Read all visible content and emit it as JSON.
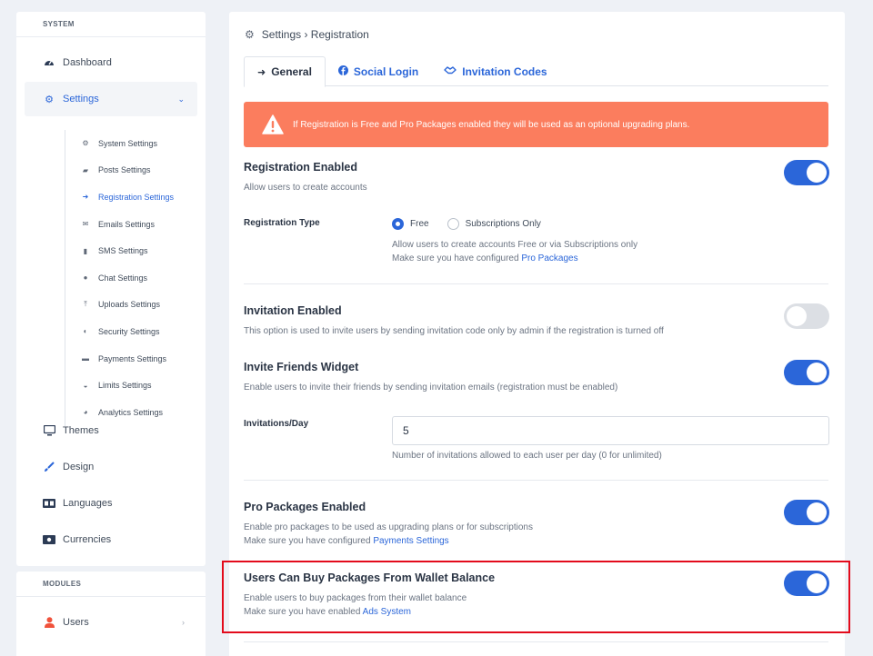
{
  "sidebar": {
    "system_label": "SYSTEM",
    "modules_label": "MODULES",
    "items": [
      {
        "label": "Dashboard",
        "icon": "gauge-icon"
      },
      {
        "label": "Settings",
        "icon": "gear-icon"
      },
      {
        "label": "Themes",
        "icon": "monitor-icon"
      },
      {
        "label": "Design",
        "icon": "brush-icon"
      },
      {
        "label": "Languages",
        "icon": "language-icon"
      },
      {
        "label": "Currencies",
        "icon": "money-icon"
      }
    ],
    "sub_items": [
      {
        "label": "System Settings",
        "icon": "gears-icon"
      },
      {
        "label": "Posts Settings",
        "icon": "comment-icon"
      },
      {
        "label": "Registration Settings",
        "icon": "sign-in-icon"
      },
      {
        "label": "Emails Settings",
        "icon": "envelope-open-icon"
      },
      {
        "label": "SMS Settings",
        "icon": "mobile-icon"
      },
      {
        "label": "Chat Settings",
        "icon": "comments-icon"
      },
      {
        "label": "Uploads Settings",
        "icon": "upload-icon"
      },
      {
        "label": "Security Settings",
        "icon": "shield-icon"
      },
      {
        "label": "Payments Settings",
        "icon": "credit-card-icon"
      },
      {
        "label": "Limits Settings",
        "icon": "tachometer-icon"
      },
      {
        "label": "Analytics Settings",
        "icon": "pie-chart-icon"
      }
    ],
    "module_items": [
      {
        "label": "Users",
        "icon": "user-icon"
      }
    ]
  },
  "breadcrumb": "Settings › Registration",
  "tabs": [
    {
      "label": "General",
      "icon": "sign-in-icon"
    },
    {
      "label": "Social Login",
      "icon": "facebook-icon"
    },
    {
      "label": "Invitation Codes",
      "icon": "handshake-icon"
    }
  ],
  "alert": "If Registration is Free and Pro Packages enabled they will be used as an optional upgrading plans.",
  "registration": {
    "title": "Registration Enabled",
    "desc": "Allow users to create accounts",
    "enabled": true
  },
  "registration_type": {
    "label": "Registration Type",
    "options": [
      "Free",
      "Subscriptions Only"
    ],
    "selected": "Free",
    "help": "Allow users to create accounts Free or via Subscriptions only",
    "help2_prefix": "Make sure you have configured ",
    "help2_link": "Pro Packages"
  },
  "invitation": {
    "title": "Invitation Enabled",
    "desc": "This option is used to invite users by sending invitation code only by admin if the registration is turned off",
    "enabled": false
  },
  "invite_friends": {
    "title": "Invite Friends Widget",
    "desc": "Enable users to invite their friends by sending invitation emails (registration must be enabled)",
    "enabled": true
  },
  "invitations_day": {
    "label": "Invitations/Day",
    "value": "5",
    "help": "Number of invitations allowed to each user per day (0 for unlimited)"
  },
  "pro_packages": {
    "title": "Pro Packages Enabled",
    "desc": "Enable pro packages to be used as upgrading plans or for subscriptions",
    "help_prefix": "Make sure you have configured ",
    "help_link": "Payments Settings",
    "enabled": true
  },
  "wallet": {
    "title": "Users Can Buy Packages From Wallet Balance",
    "desc": "Enable users to buy packages from their wallet balance",
    "help_prefix": "Make sure you have enabled ",
    "help_link": "Ads System",
    "enabled": true
  },
  "colors": {
    "accent": "#2b66d9",
    "alert": "#fb7d5e",
    "highlight": "#e30b1c"
  }
}
